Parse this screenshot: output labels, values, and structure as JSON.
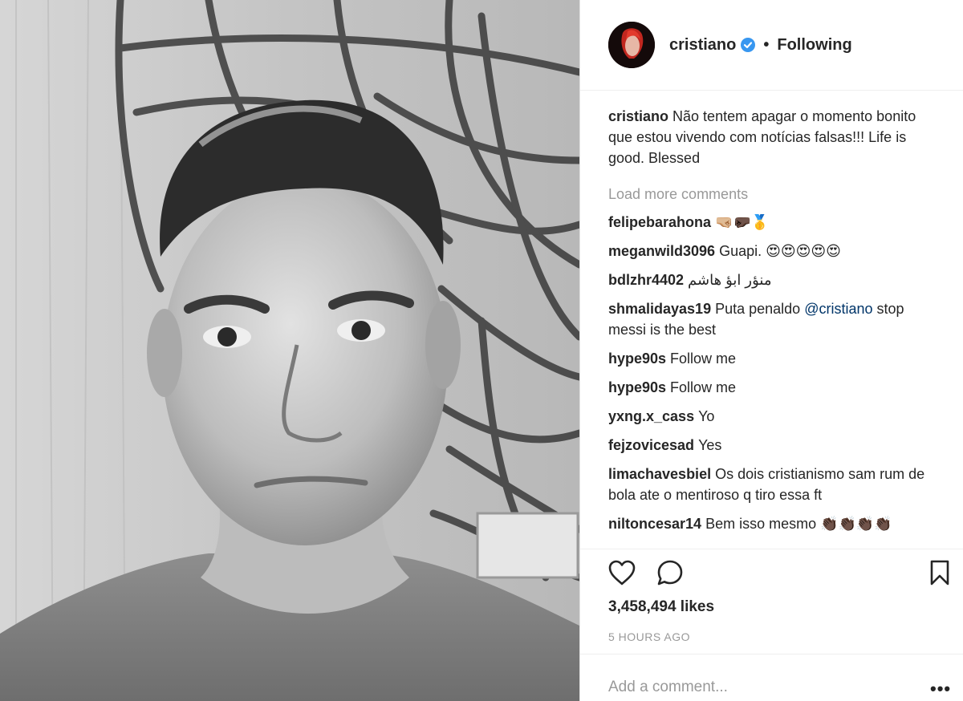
{
  "post": {
    "username": "cristiano",
    "verified": true,
    "follow_separator": "•",
    "follow_status": "Following",
    "caption_text": "Não tentem apagar o momento bonito que estou vivendo com notícias falsas!!! Life is good. Blessed",
    "load_more": "Load more comments",
    "likes": "3,458,494 likes",
    "timestamp": "5 HOURS AGO",
    "add_comment_placeholder": "Add a comment...",
    "more_options": "•••"
  },
  "comments": [
    {
      "user": "felipebarahona",
      "text": "🤜🏼🤛🏿🥇"
    },
    {
      "user": "meganwild3096",
      "text": "Guapi. 😍😍😍😍😍"
    },
    {
      "user": "bdlzhr4402",
      "text": "منؤر ابؤ هاشم"
    },
    {
      "user": "shmalidayas19",
      "text": "Puta penaldo ",
      "mention": "@cristiano",
      "text_after": " stop messi is the best"
    },
    {
      "user": "hype90s",
      "text": "Follow me"
    },
    {
      "user": "hype90s",
      "text": "Follow me"
    },
    {
      "user": "yxng.x_cass",
      "text": "Yo"
    },
    {
      "user": "fejzovicesad",
      "text": "Yes"
    },
    {
      "user": "limachavesbiel",
      "text": "Os dois cristianismo sam rum de bola ate o mentiroso q tiro essa ft"
    },
    {
      "user": "niltoncesar14",
      "text": "Bem isso mesmo 👏🏿👏🏿👏🏿👏🏿"
    }
  ],
  "icons": {
    "like": "heart-icon",
    "comment": "speech-bubble-icon",
    "save": "bookmark-icon",
    "verified": "verified-badge-icon"
  },
  "colors": {
    "verified_blue": "#3897f0",
    "mention_blue": "#003569",
    "muted_gray": "#999999",
    "text": "#262626"
  }
}
